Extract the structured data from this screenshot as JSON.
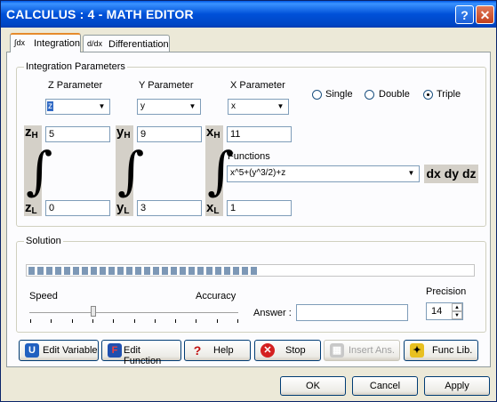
{
  "window": {
    "title": "CALCULUS : 4 - MATH EDITOR",
    "help_glyph": "?",
    "close_glyph": "✕"
  },
  "tabs": [
    {
      "icon": "∫dx",
      "label": "Integration",
      "active": true
    },
    {
      "icon": "d/dx",
      "label": "Differentiation",
      "active": false
    }
  ],
  "params": {
    "group_title": "Integration Parameters",
    "z": {
      "label": "Z Parameter",
      "value": "z",
      "upper": "5",
      "lower": "0",
      "upper_sym": "z",
      "upper_sub": "H",
      "lower_sym": "z",
      "lower_sub": "L"
    },
    "y": {
      "label": "Y Parameter",
      "value": "y",
      "upper": "9",
      "lower": "3",
      "upper_sym": "y",
      "upper_sub": "H",
      "lower_sym": "y",
      "lower_sub": "L"
    },
    "x": {
      "label": "X Parameter",
      "value": "x",
      "upper": "11",
      "lower": "1",
      "upper_sym": "x",
      "upper_sub": "H",
      "lower_sym": "x",
      "lower_sub": "L"
    },
    "modes": [
      {
        "label": "Single",
        "selected": false
      },
      {
        "label": "Double",
        "selected": false
      },
      {
        "label": "Triple",
        "selected": true
      }
    ],
    "functions_label": "Functions",
    "function_value": "x^5+(y^3/2)+z",
    "differentials": "dx dy dz",
    "integral_glyph": "∫"
  },
  "solution": {
    "group_title": "Solution",
    "progress_segments_filled": 26,
    "speed_label": "Speed",
    "accuracy_label": "Accuracy",
    "answer_label": "Answer :",
    "answer_value": "",
    "precision_label": "Precision",
    "precision_value": "14"
  },
  "toolbar": {
    "edit_variable": "Edit Variable",
    "edit_function": "Edit Function",
    "help": "Help",
    "stop": "Stop",
    "insert_ans": "Insert Ans.",
    "func_lib": "Func Lib."
  },
  "dialog": {
    "ok": "OK",
    "cancel": "Cancel",
    "apply": "Apply"
  },
  "colors": {
    "title_bar": "#0054e3",
    "progress": "#7d98b6",
    "stop_icon": "#d42020"
  }
}
